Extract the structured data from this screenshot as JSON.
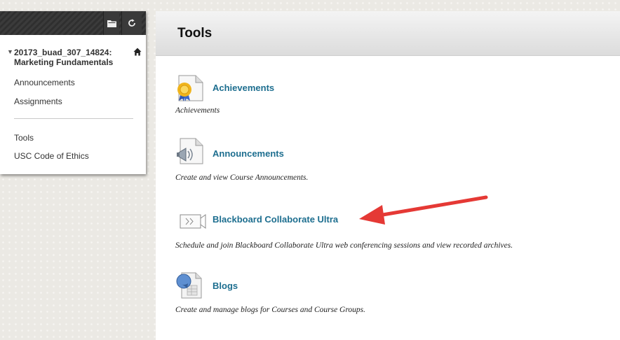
{
  "course_menu": {
    "course_title_line1": "20173_buad_307_14824:",
    "course_title_line2": "Marketing Fundamentals",
    "items": [
      {
        "label": "Announcements"
      },
      {
        "label": "Assignments"
      },
      {
        "label": "Tools"
      },
      {
        "label": "USC Code of Ethics"
      }
    ]
  },
  "page": {
    "title": "Tools"
  },
  "tools": [
    {
      "name": "Achievements",
      "description": "Achievements",
      "icon": "achievements-ribbon-icon"
    },
    {
      "name": "Announcements",
      "description": "Create and view Course Announcements.",
      "icon": "megaphone-icon"
    },
    {
      "name": "Blackboard Collaborate Ultra",
      "description": "Schedule and join Blackboard Collaborate Ultra web conferencing sessions and view recorded archives.",
      "icon": "video-camera-icon"
    },
    {
      "name": "Blogs",
      "description": "Create and manage blogs for Courses and Course Groups.",
      "icon": "blog-document-icon"
    }
  ],
  "colors": {
    "link": "#1d6e8f",
    "annotation_arrow": "#e53935"
  }
}
